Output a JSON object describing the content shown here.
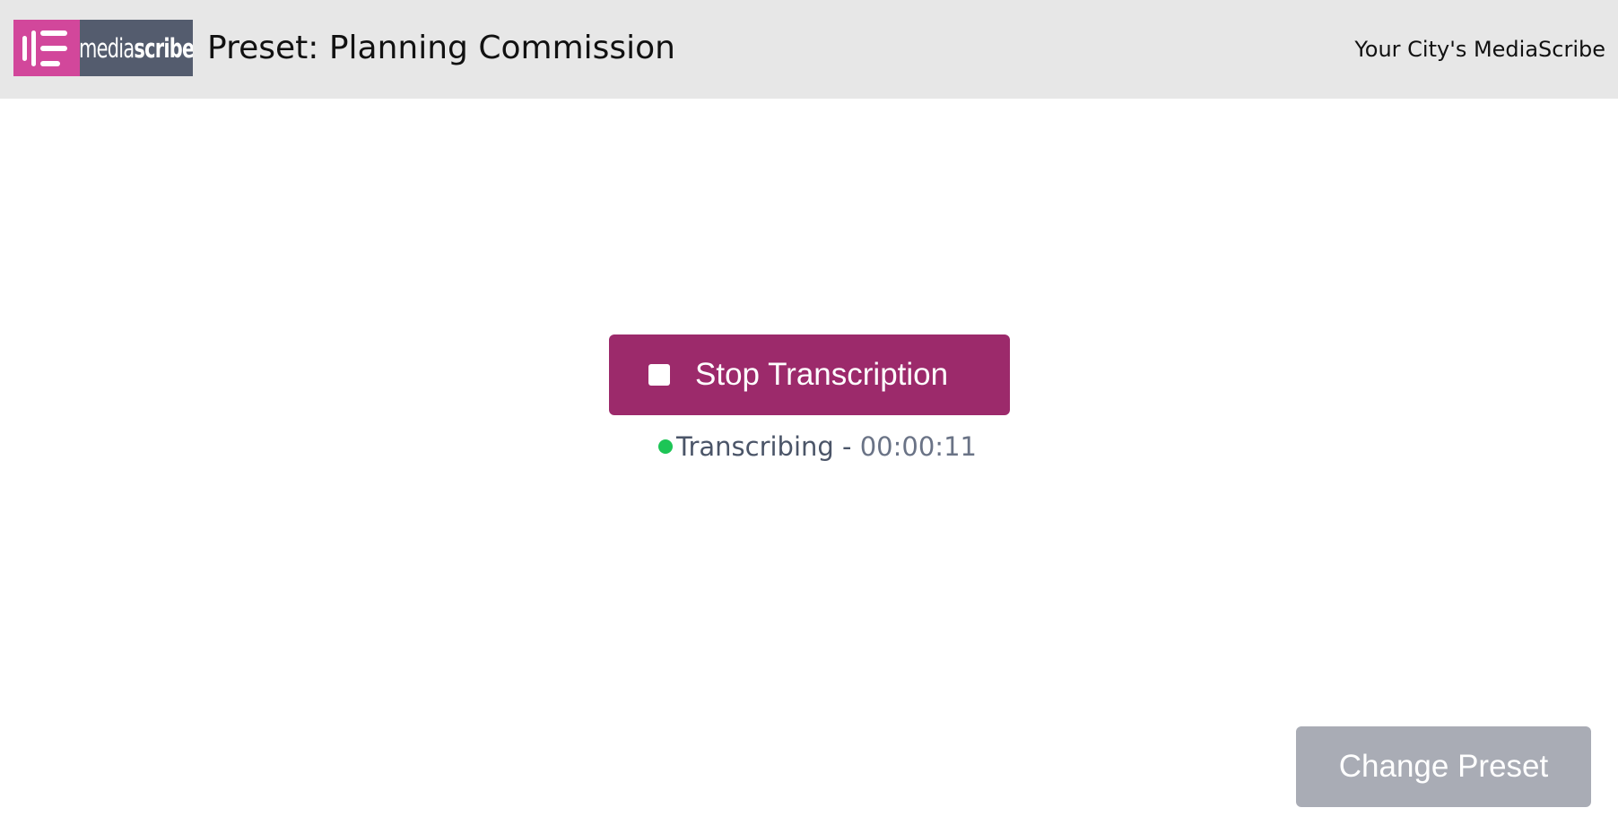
{
  "header": {
    "logo": {
      "wordmark_light": "media",
      "wordmark_bold": "scribe",
      "mark_color": "#d2479b",
      "word_bg_color": "#545c6e"
    },
    "preset_title": "Preset: Planning Commission",
    "city_label": "Your City's MediaScribe",
    "background_color": "#e7e7e7"
  },
  "main": {
    "stop_button": {
      "label": "Stop Transcription",
      "icon": "stop-square-icon",
      "color": "#9c2a6b"
    },
    "status": {
      "indicator_color": "#1dc556",
      "label": "Transcribing",
      "separator": "-",
      "elapsed": "00:00:11"
    }
  },
  "footer": {
    "change_preset_button": {
      "label": "Change Preset",
      "color": "#a9acb5"
    }
  }
}
